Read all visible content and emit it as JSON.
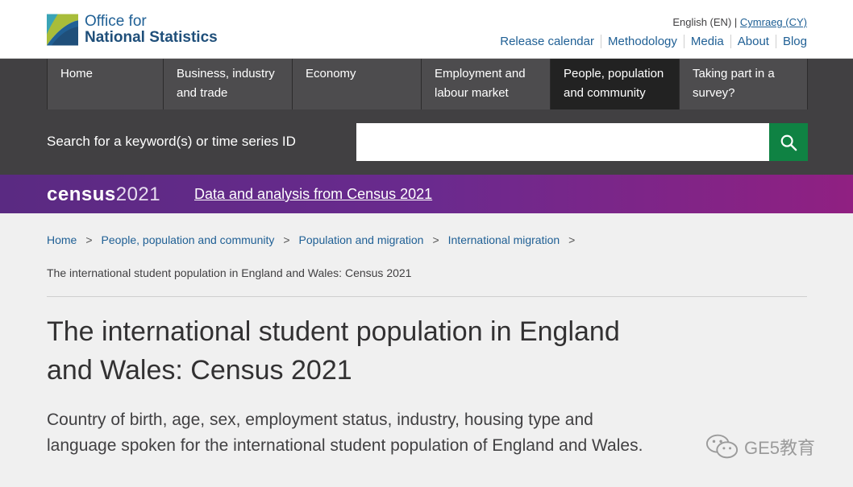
{
  "header": {
    "logo_line1": "Office for",
    "logo_line2": "National Statistics",
    "lang_current": "English (EN)",
    "lang_sep": "|",
    "lang_alt": "Cymraeg (CY)",
    "top_links": [
      "Release calendar",
      "Methodology",
      "Media",
      "About",
      "Blog"
    ]
  },
  "nav": {
    "items": [
      {
        "line1": "Home",
        "line2": ""
      },
      {
        "line1": "Business, industry",
        "line2": "and trade"
      },
      {
        "line1": "Economy",
        "line2": ""
      },
      {
        "line1": "Employment and",
        "line2": "labour market"
      },
      {
        "line1": "People, population",
        "line2": "and community"
      },
      {
        "line1": "Taking part in a",
        "line2": "survey?"
      }
    ],
    "active_index": 4
  },
  "search": {
    "label": "Search for a keyword(s) or time series ID",
    "value": "",
    "icon": "search-icon"
  },
  "census_banner": {
    "logo_word": "census",
    "logo_year": "2021",
    "link_text": "Data and analysis from Census 2021"
  },
  "breadcrumb": {
    "items": [
      "Home",
      "People, population and community",
      "Population and migration",
      "International migration"
    ],
    "separator": ">",
    "current": "The international student population in England and Wales: Census 2021"
  },
  "page": {
    "title": "The international student population in England and Wales: Census 2021",
    "lede": "Country of birth, age, sex, employment status, industry, housing type and language spoken for the international student population of England and Wales."
  },
  "watermark": {
    "text": "GE5教育",
    "icon": "wechat-icon"
  },
  "colors": {
    "ons_blue": "#206095",
    "nav_bg": "#414042",
    "nav_active": "#222222",
    "search_button": "#0f8243",
    "census_purple": "#5a2a82"
  }
}
